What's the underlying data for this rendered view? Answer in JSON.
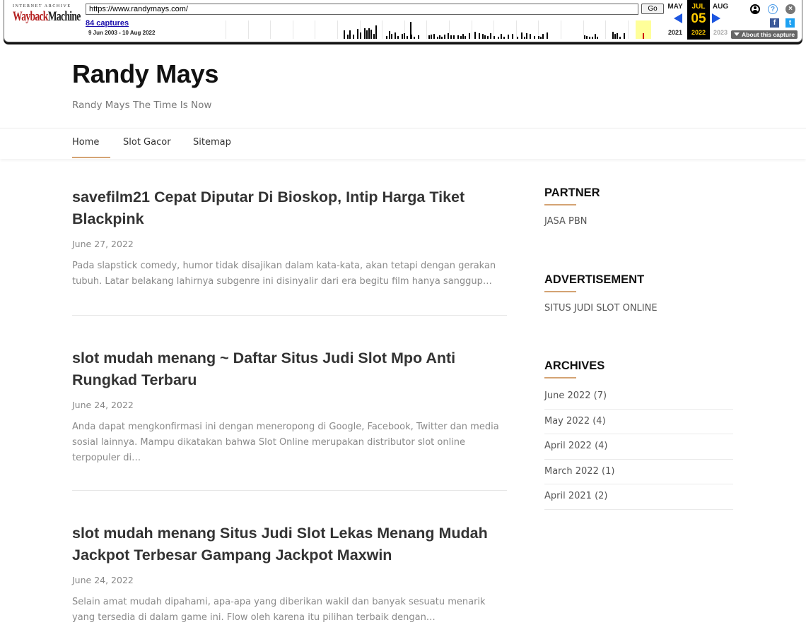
{
  "wayback": {
    "logo_top": "INTERNET ARCHIVE",
    "logo_wayback": "Wayback",
    "logo_machine": "Machine",
    "url": "https://www.randymays.com/",
    "go_label": "Go",
    "captures_label": "84 captures",
    "date_range": "9 Jun 2003 - 10 Aug 2022",
    "months": {
      "prev": "MAY",
      "current": "JUL",
      "next": "AUG"
    },
    "day": "05",
    "years": {
      "prev": "2021",
      "current": "2022",
      "next": "2023"
    },
    "about_label": "About this capture",
    "icons": {
      "user": "user-icon",
      "help": "help-icon",
      "close": "close-icon",
      "facebook": "facebook-icon",
      "twitter": "twitter-icon"
    }
  },
  "site": {
    "title": "Randy Mays",
    "tagline": "Randy Mays The Time Is Now"
  },
  "nav": {
    "items": [
      {
        "label": "Home",
        "active": true
      },
      {
        "label": "Slot Gacor",
        "active": false
      },
      {
        "label": "Sitemap",
        "active": false
      }
    ]
  },
  "posts": [
    {
      "title": "savefilm21 Cepat Diputar Di Bioskop, Intip Harga Tiket Blackpink",
      "date": "June 27, 2022",
      "excerpt": "Pada slapstick comedy, humor tidak disajikan dalam kata-kata, akan tetapi dengan gerakan tubuh. Latar belakang lahirnya subgenre ini disinyalir dari era begitu film hanya sanggup…"
    },
    {
      "title": "slot mudah menang ~ Daftar Situs Judi Slot Mpo Anti Rungkad Terbaru",
      "date": "June 24, 2022",
      "excerpt": "Anda dapat mengkonfirmasi ini dengan meneropong di Google, Facebook, Twitter dan media sosial lainnya. Mampu dikatakan bahwa Slot Online merupakan distributor slot online terpopuler di…"
    },
    {
      "title": "slot mudah menang Situs Judi Slot Lekas Menang Mudah Jackpot Terbesar Gampang Jackpot Maxwin",
      "date": "June 24, 2022",
      "excerpt": "Selain amat mudah dipahami, apa-apa yang diberikan wakil dan banyak sesuatu menarik yang tersedia di dalam game ini. Flow oleh karena itu pilihan terbaik dengan…"
    }
  ],
  "sidebar": {
    "partner": {
      "title": "PARTNER",
      "link": "JASA PBN"
    },
    "advertisement": {
      "title": "ADVERTISEMENT",
      "link": "SITUS JUDI SLOT ONLINE"
    },
    "archives": {
      "title": "ARCHIVES",
      "items": [
        {
          "label": "June 2022",
          "count": "(7)"
        },
        {
          "label": "May 2022",
          "count": "(4)"
        },
        {
          "label": "April 2022",
          "count": "(4)"
        },
        {
          "label": "March 2022",
          "count": "(1)"
        },
        {
          "label": "April 2021",
          "count": "(2)"
        }
      ]
    }
  },
  "colors": {
    "accent": "#d4a373",
    "wayback_highlight": "#ffcc00",
    "arrow": "#1d56e0"
  }
}
